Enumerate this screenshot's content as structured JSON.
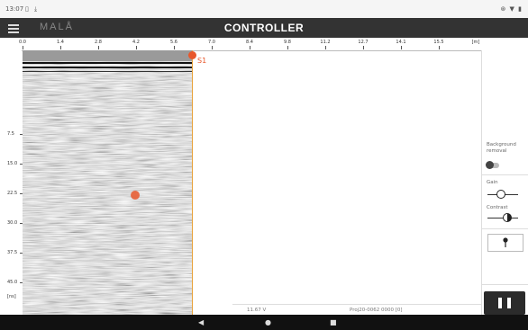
{
  "status_bar": {
    "time": "13:07",
    "right_icons": "⊛ ▼ ▮"
  },
  "app_bar": {
    "logo": "MALÅ",
    "title": "CONTROLLER"
  },
  "distance_axis": {
    "unit": "[m]",
    "ticks": [
      "0.0",
      "1.4",
      "2.8",
      "4.2",
      "5.6",
      "7.0",
      "8.4",
      "9.8",
      "11.2",
      "12.7",
      "14.1",
      "15.5"
    ]
  },
  "depth_axis": {
    "unit": "[ns]",
    "ticks": [
      "0.0",
      "7.5",
      "15.0",
      "22.5",
      "30.0",
      "37.5",
      "45.0"
    ]
  },
  "marker": {
    "label": "S1"
  },
  "panel": {
    "background_removal_label": "Background removal",
    "background_removal_on": false,
    "gain_label": "Gain",
    "gain_level": 0.45,
    "contrast_label": "Contrast",
    "contrast_level": 0.65,
    "probe_icon": "pin-icon",
    "pause_icon": "pause-icon"
  },
  "info_bar": {
    "voltage": "11.67 V",
    "project": "Proj20-0062 0000 [0]"
  },
  "colors": {
    "accent": "#e8572b",
    "appbar": "#333333",
    "nav": "#111111"
  }
}
